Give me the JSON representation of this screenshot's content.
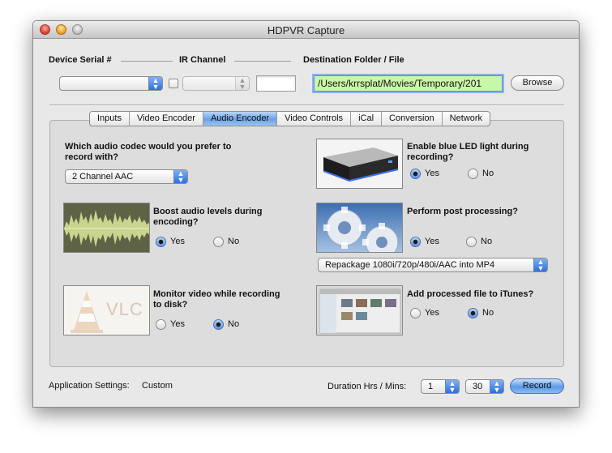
{
  "window": {
    "title": "HDPVR Capture"
  },
  "top": {
    "device_serial_label": "Device Serial #",
    "ir_channel_label": "IR Channel",
    "destination_label": "Destination Folder / File",
    "destination_value": "/Users/krrsplat/Movies/Temporary/201",
    "browse_label": "Browse"
  },
  "tabs": [
    {
      "label": "Inputs"
    },
    {
      "label": "Video Encoder"
    },
    {
      "label": "Audio Encoder"
    },
    {
      "label": "Video Controls"
    },
    {
      "label": "iCal"
    },
    {
      "label": "Conversion"
    },
    {
      "label": "Network"
    }
  ],
  "audio": {
    "codec_question": "Which audio codec would you prefer to record with?",
    "codec_value": "2 Channel AAC",
    "boost_question": "Boost audio levels during encoding?",
    "monitor_question": "Monitor video while recording to disk?",
    "led_question": "Enable blue LED light during recording?",
    "post_question": "Perform post processing?",
    "post_option": "Repackage 1080i/720p/480i/AAC into MP4",
    "itunes_question": "Add processed file to iTunes?",
    "yes": "Yes",
    "no": "No",
    "vlc_text": "VLC"
  },
  "bottom": {
    "app_settings_label": "Application Settings:",
    "app_settings_value": "Custom",
    "duration_label": "Duration Hrs / Mins:",
    "hours_value": "1",
    "mins_value": "30",
    "record_label": "Record"
  },
  "colors": {
    "accent": "#5c9ae8",
    "dest_field": "#c9f7a8"
  }
}
